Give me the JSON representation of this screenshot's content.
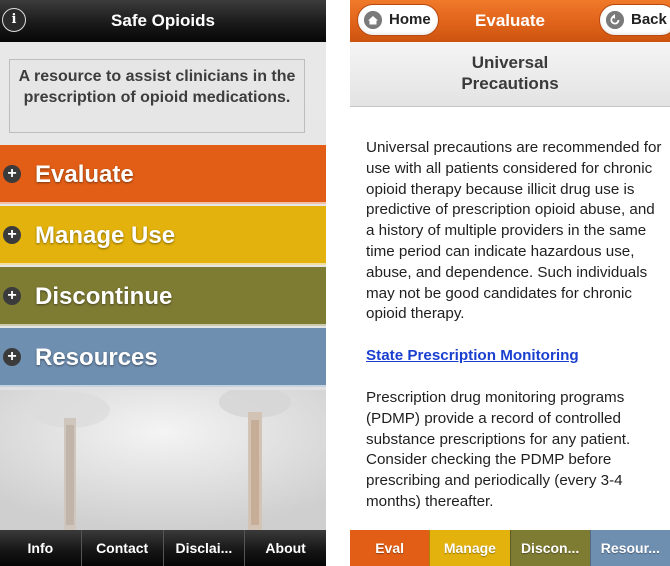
{
  "left_screen": {
    "header": {
      "title": "Safe Opioids",
      "info_glyph": "i"
    },
    "tagline": "A resource to assist clinicians in the prescription of opioid medications.",
    "menu": [
      {
        "label": "Evaluate",
        "color": "#e25e16"
      },
      {
        "label": "Manage Use",
        "color": "#e3b20c"
      },
      {
        "label": "Discontinue",
        "color": "#7e7b33"
      },
      {
        "label": "Resources",
        "color": "#6f8fb1"
      }
    ],
    "tabbar": [
      "Info",
      "Contact",
      "Disclai...",
      "About"
    ]
  },
  "right_screen": {
    "header": {
      "title": "Evaluate",
      "home_label": "Home",
      "back_label": "Back"
    },
    "subheader": {
      "line1": "Universal",
      "line2": "Precautions"
    },
    "content": {
      "paragraph1": "Universal precautions are recommended for use with all patients considered for chronic opioid therapy because illicit drug use is predictive of prescription opioid abuse, and a history of multiple providers in the same time period can indicate hazardous use, abuse, and dependence. Such individuals may not be good candidates for chronic opioid therapy.",
      "link": "State Prescription Monitoring",
      "paragraph2": "Prescription drug monitoring programs (PDMP) provide a record of controlled substance prescriptions for any patient. Consider checking the PDMP before prescribing and periodically (every 3-4 months) thereafter."
    },
    "tabbar": [
      {
        "label": "Eval",
        "color": "#e25e16"
      },
      {
        "label": "Manage",
        "color": "#e3b20c"
      },
      {
        "label": "Discon...",
        "color": "#7e7b33"
      },
      {
        "label": "Resour...",
        "color": "#6f8fb1"
      }
    ]
  }
}
